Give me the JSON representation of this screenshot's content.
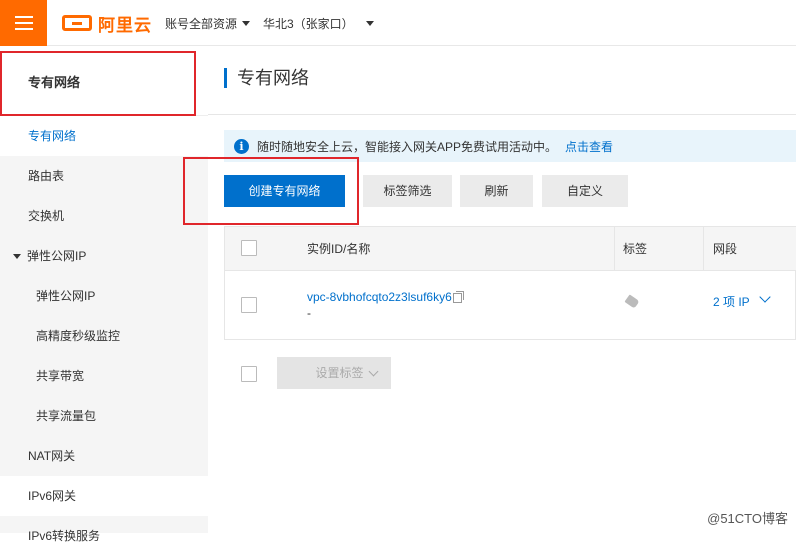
{
  "header": {
    "logo_text": "阿里云",
    "account_dropdown": "账号全部资源",
    "region_dropdown": "华北3（张家口）"
  },
  "sidebar": {
    "header": "专有网络",
    "items": [
      {
        "label": "专有网络",
        "active": true,
        "level": 1
      },
      {
        "label": "路由表",
        "level": 1
      },
      {
        "label": "交换机",
        "level": 1
      },
      {
        "label": "弹性公网IP",
        "level": 1,
        "expanded": true
      },
      {
        "label": "弹性公网IP",
        "level": 2
      },
      {
        "label": "高精度秒级监控",
        "level": 2
      },
      {
        "label": "共享带宽",
        "level": 2
      },
      {
        "label": "共享流量包",
        "level": 2
      },
      {
        "label": "NAT网关",
        "level": 1
      },
      {
        "label": "IPv6网关",
        "level": 1
      },
      {
        "label": "IPv6转换服务",
        "level": 1
      }
    ]
  },
  "main": {
    "title": "专有网络",
    "notice": {
      "text": "随时随地安全上云，智能接入网关APP免费试用活动中。",
      "link": "点击查看"
    },
    "toolbar": {
      "create": "创建专有网络",
      "tag_filter": "标签筛选",
      "refresh": "刷新",
      "customize": "自定义"
    },
    "table": {
      "columns": [
        "实例ID/名称",
        "标签",
        "网段"
      ],
      "rows": [
        {
          "id": "vpc-8vbhofcqto2z3lsuf6ky6",
          "name": "-",
          "cidr": "2 项 IP"
        }
      ]
    },
    "set_tags": "设置标签"
  },
  "watermark": "@51CTO博客",
  "colors": {
    "accent": "#0070cc",
    "brand": "#ff6a00",
    "annotation": "#e0262b"
  }
}
